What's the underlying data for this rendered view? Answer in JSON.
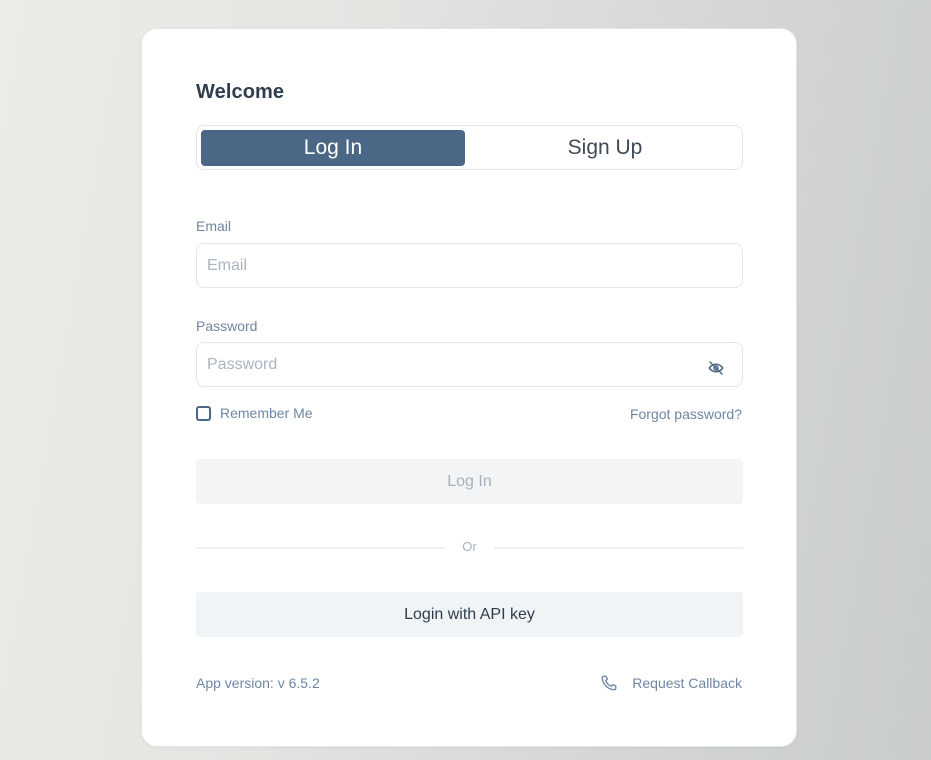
{
  "title": "Welcome",
  "tabs": {
    "login_label": "Log In",
    "signup_label": "Sign Up"
  },
  "email": {
    "label": "Email",
    "placeholder": "Email",
    "value": ""
  },
  "password": {
    "label": "Password",
    "placeholder": "Password",
    "value": "",
    "toggle_icon": "eye-off-icon"
  },
  "remember": {
    "label": "Remember Me",
    "checked": false
  },
  "forgot_label": "Forgot password?",
  "login_button_label": "Log In",
  "divider_label": "Or",
  "api_button_label": "Login with API key",
  "version_label": "App version: v 6.5.2",
  "callback": {
    "label": "Request Callback",
    "icon": "phone-icon"
  },
  "colors": {
    "accent": "#4a6785",
    "label_text": "#6f86a2",
    "disabled_button_bg": "#f2f4f6"
  }
}
